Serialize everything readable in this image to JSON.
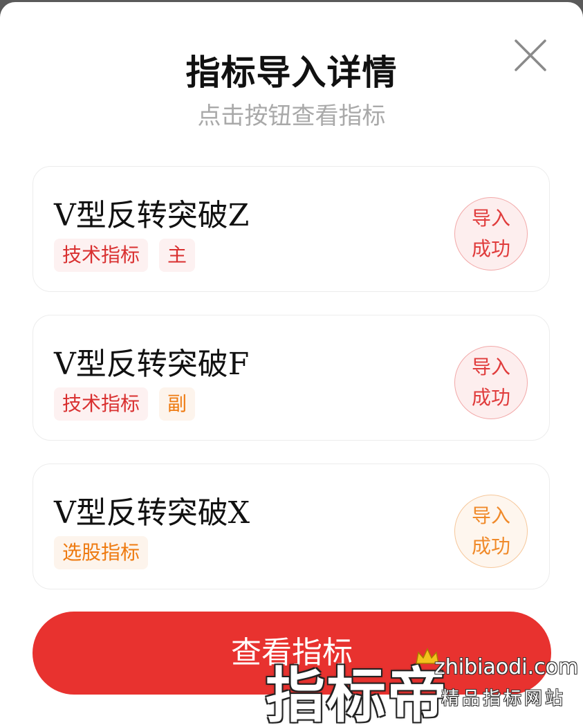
{
  "dialog": {
    "title": "指标导入详情",
    "subtitle": "点击按钮查看指标"
  },
  "cards": [
    {
      "name": "V型反转突破Z",
      "tags": [
        "技术指标",
        "主"
      ],
      "status_line1": "导入",
      "status_line2": "成功"
    },
    {
      "name": "V型反转突破F",
      "tags": [
        "技术指标",
        "副"
      ],
      "status_line1": "导入",
      "status_line2": "成功"
    },
    {
      "name": "V型反转突破X",
      "tags": [
        "选股指标"
      ],
      "status_line1": "导入",
      "status_line2": "成功"
    }
  ],
  "view_button_label": "查看指标",
  "watermark": {
    "brand": "指标帝",
    "url": "zhibiaodi.com",
    "slogan": "精品指标网站"
  },
  "icons": {
    "close": "close-icon",
    "crown": "crown-icon"
  },
  "colors": {
    "primary": "#e8322f",
    "tag_red": "#d93030",
    "tag_orange": "#ee7a10"
  }
}
